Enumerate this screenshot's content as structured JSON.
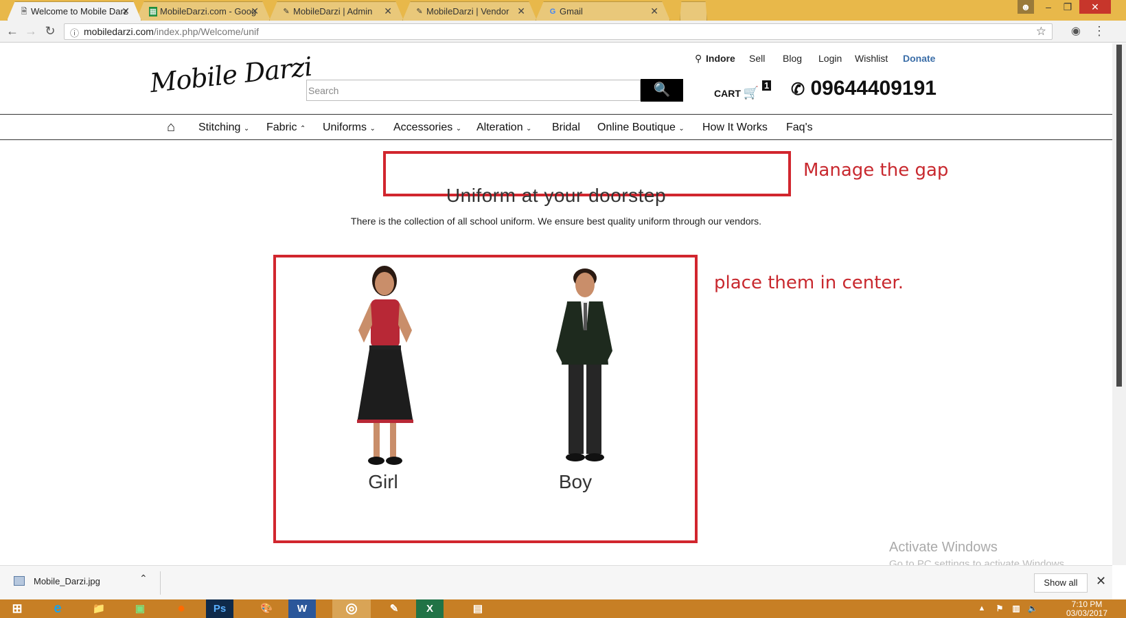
{
  "browser": {
    "tabs": [
      {
        "label": "Welcome to Mobile Darz",
        "icon": "page-icon",
        "active": true
      },
      {
        "label": "MobileDarzi.com - Goog",
        "icon": "sheets-icon"
      },
      {
        "label": "MobileDarzi | Admin",
        "icon": "page-icon"
      },
      {
        "label": "MobileDarzi | Vendor",
        "icon": "page-icon"
      },
      {
        "label": "Gmail",
        "icon": "google-icon"
      }
    ],
    "url_host": "mobiledarzi.com",
    "url_path": "/index.php/Welcome/unif"
  },
  "site": {
    "logo_text": "Mobile Darzi",
    "top_links": {
      "location": "Indore",
      "sell": "Sell",
      "blog": "Blog",
      "login": "Login",
      "wishlist": "Wishlist",
      "donate": "Donate"
    },
    "search_placeholder": "Search",
    "cart_label": "CART",
    "cart_count": "1",
    "phone": "09644409191",
    "nav": {
      "stitching": "Stitching",
      "fabric": "Fabric",
      "uniforms": "Uniforms",
      "accessories": "Accessories",
      "alteration": "Alteration",
      "bridal": "Bridal",
      "online_boutique": "Online Boutique",
      "how_it_works": "How It Works",
      "faqs": "Faq's"
    },
    "heading": "Uniform at your doorstep",
    "subtext": "There is the collection of all school uniform. We ensure best quality uniform through our vendors.",
    "products": {
      "girl": "Girl",
      "boy": "Boy"
    }
  },
  "annotations": {
    "gap_note": "Manage the gap",
    "center_note": "place them in center."
  },
  "watermark": {
    "line1": "Activate Windows",
    "line2": "Go to PC settings to activate Windows."
  },
  "download_bar": {
    "file": "Mobile_Darzi.jpg",
    "show_all": "Show all"
  },
  "taskbar": {
    "time": "7:10 PM",
    "date": "03/03/2017"
  },
  "colors": {
    "annotation_red": "#d1262e",
    "donate_blue": "#3b6ea8",
    "taskbar": "#c77f25"
  }
}
